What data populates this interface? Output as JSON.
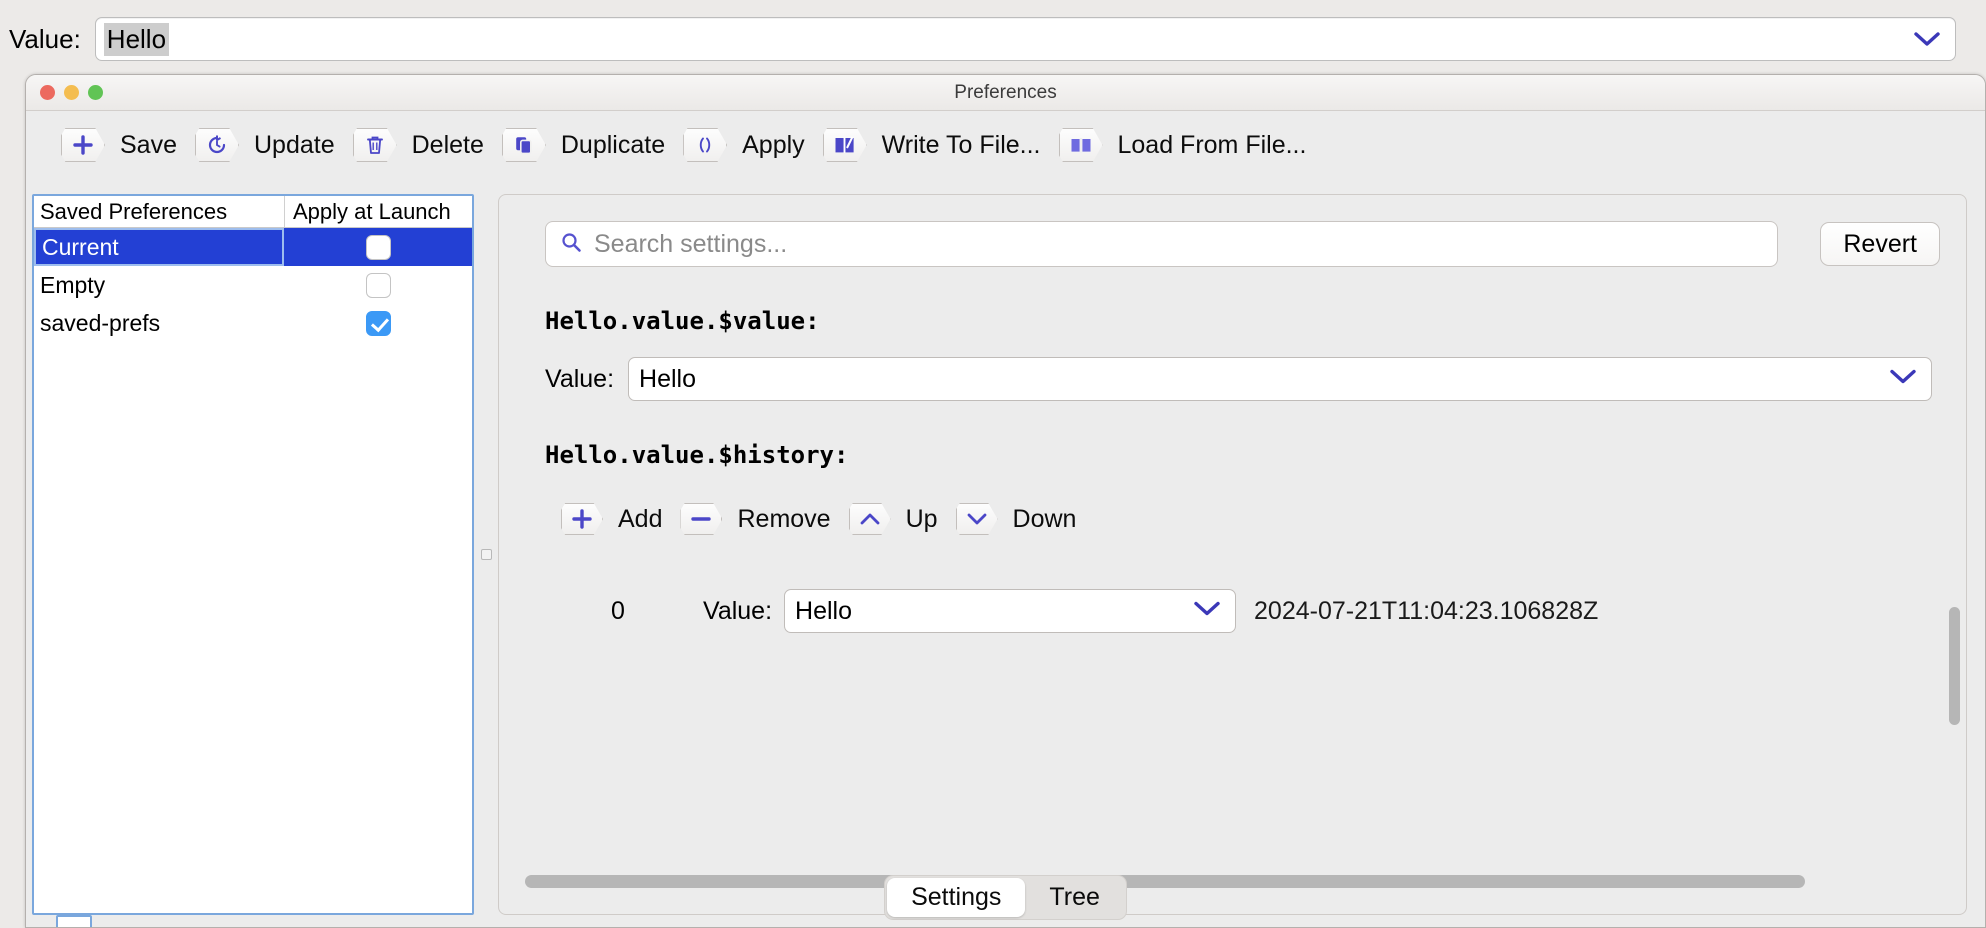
{
  "top_bar": {
    "label": "Value:",
    "value": "Hello",
    "dropdown_icon": "chevron-down-icon"
  },
  "window": {
    "title": "Preferences",
    "traffic_lights": [
      {
        "name": "close",
        "color": "#ec6a5f"
      },
      {
        "name": "minimize",
        "color": "#f4bd50"
      },
      {
        "name": "zoom",
        "color": "#61c455"
      }
    ]
  },
  "toolbar": {
    "buttons": [
      {
        "label": "Save",
        "icon": "plus-icon"
      },
      {
        "label": "Update",
        "icon": "refresh-clock-icon"
      },
      {
        "label": "Delete",
        "icon": "trash-icon"
      },
      {
        "label": "Duplicate",
        "icon": "copy-icon"
      },
      {
        "label": "Apply",
        "icon": "parentheses-icon"
      },
      {
        "label": "Write To File...",
        "icon": "book-write-icon"
      },
      {
        "label": "Load From File...",
        "icon": "book-open-icon"
      }
    ]
  },
  "saved_preferences": {
    "columns": [
      "Saved Preferences",
      "Apply at Launch"
    ],
    "rows": [
      {
        "name": "Current",
        "apply_at_launch": false,
        "selected": true
      },
      {
        "name": "Empty",
        "apply_at_launch": false,
        "selected": false
      },
      {
        "name": "saved-prefs",
        "apply_at_launch": true,
        "selected": false
      }
    ]
  },
  "settings_panel": {
    "search": {
      "placeholder": "Search settings...",
      "value": "",
      "icon": "search-icon"
    },
    "revert_label": "Revert",
    "groups": [
      {
        "key_label": "Hello.value.$value:",
        "value_label": "Value:",
        "value": "Hello",
        "dropdown_icon": "chevron-down-icon"
      },
      {
        "key_label": "Hello.value.$history:",
        "toolbar": [
          {
            "label": "Add",
            "icon": "plus-icon"
          },
          {
            "label": "Remove",
            "icon": "minus-icon"
          },
          {
            "label": "Up",
            "icon": "chevron-up-icon"
          },
          {
            "label": "Down",
            "icon": "chevron-down-icon"
          }
        ],
        "entries": [
          {
            "index": "0",
            "value_label": "Value:",
            "value": "Hello",
            "timestamp": "2024-07-21T11:04:23.106828Z",
            "dropdown_icon": "chevron-down-icon"
          }
        ]
      }
    ]
  },
  "bottom_tabs": {
    "tabs": [
      {
        "label": "Settings",
        "active": true
      },
      {
        "label": "Tree",
        "active": false
      }
    ]
  },
  "colors": {
    "accent_purple": "#4b47c8",
    "selection_blue": "#2340d4",
    "checkbox_blue": "#3b99f6",
    "window_bg": "#ececec"
  }
}
